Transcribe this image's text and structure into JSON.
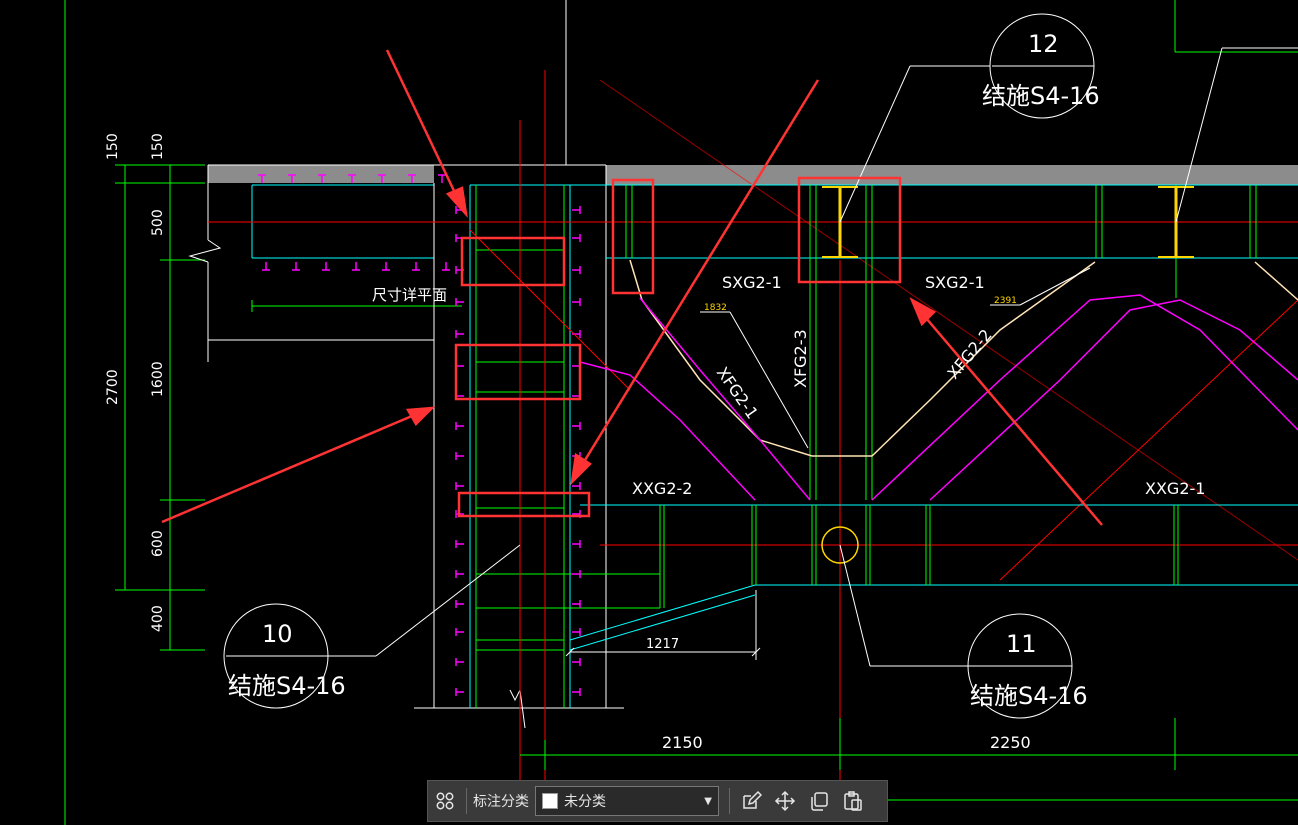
{
  "drawing": {
    "dimensions": {
      "d150a": "150",
      "d150b": "150",
      "d500": "500",
      "d2700": "2700",
      "d1600": "1600",
      "d600": "600",
      "d400": "400",
      "d2150": "2150",
      "d2250": "2250",
      "d1217": "1217",
      "d1832": "1832",
      "d2391": "2391"
    },
    "labels": {
      "sxg_left": "SXG2-1",
      "sxg_right": "SXG2-1",
      "xfg21": "XFG2-1",
      "xfg23": "XFG2-3",
      "xfg22": "XFG2-2",
      "xxg22": "XXG2-2",
      "xxg21": "XXG2-1",
      "size_note": "尺寸详平面"
    },
    "callouts": {
      "c12_num": "12",
      "c12_ref": "结施S4-16",
      "c10_num": "10",
      "c10_ref": "结施S4-16",
      "c11_num": "11",
      "c11_ref": "结施S4-16"
    },
    "colors": {
      "background": "#000000",
      "green": "#00ff00",
      "cyan": "#00ffff",
      "magenta": "#ff00ff",
      "red_line": "#ff0000",
      "highlight": "#ff3333",
      "slab_gray": "#8c8c8c",
      "yellow": "#ffd700",
      "white": "#ffffff"
    }
  },
  "toolbar": {
    "grid_icon": "grid-icon",
    "label": "标注分类",
    "select_value": "未分类",
    "edit_icon": "edit-icon",
    "move_icon": "move-icon",
    "copy_icon": "copy-icon",
    "paste_icon": "paste-icon"
  }
}
